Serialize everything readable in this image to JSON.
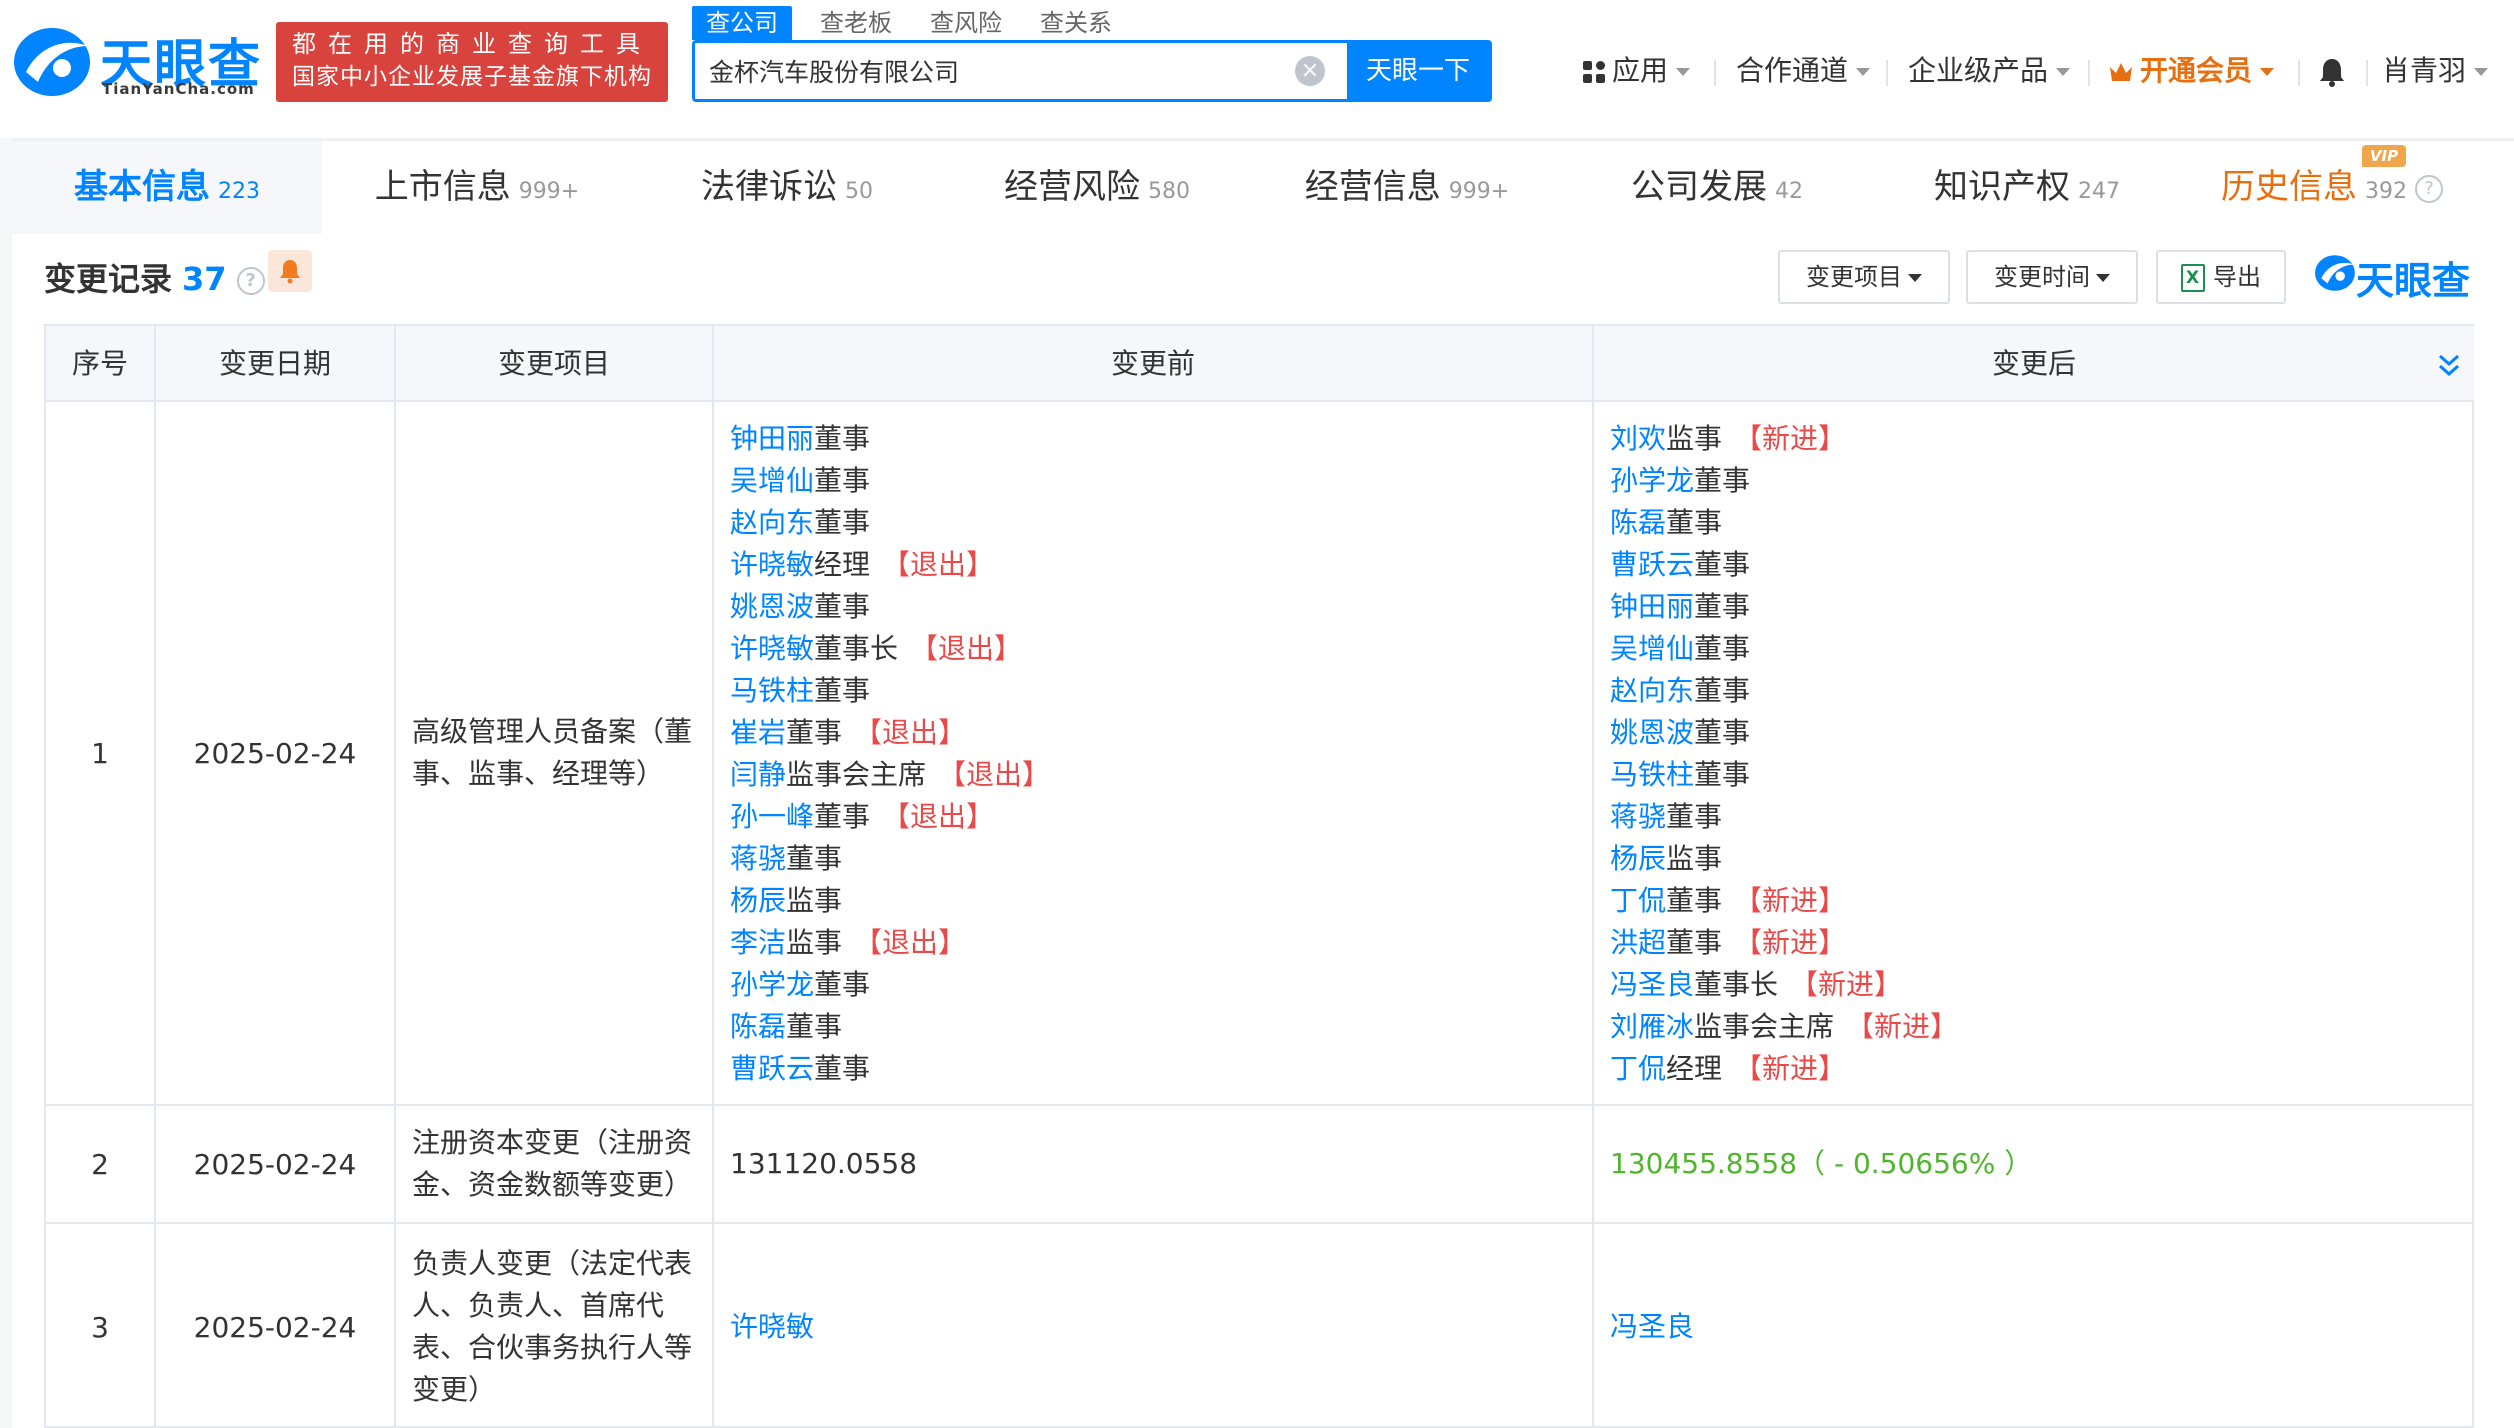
{
  "header": {
    "logo_text": "天眼查",
    "logo_sub": "TianYanCha.com",
    "slogan_line1": "都在用的商业查询工具",
    "slogan_line2": "国家中小企业发展子基金旗下机构",
    "search_tabs": [
      "查公司",
      "查老板",
      "查风险",
      "查关系"
    ],
    "search_value": "金杯汽车股份有限公司",
    "search_button": "天眼一下",
    "nav": {
      "apps": "应用",
      "partner": "合作通道",
      "enterprise": "企业级产品",
      "vip": "开通会员",
      "user": "肖青羽"
    }
  },
  "tabs": [
    {
      "label": "基本信息",
      "count": "223"
    },
    {
      "label": "上市信息",
      "count": "999+"
    },
    {
      "label": "法律诉讼",
      "count": "50"
    },
    {
      "label": "经营风险",
      "count": "580"
    },
    {
      "label": "经营信息",
      "count": "999+"
    },
    {
      "label": "公司发展",
      "count": "42"
    },
    {
      "label": "知识产权",
      "count": "247"
    },
    {
      "label": "历史信息",
      "count": "392",
      "badge": "VIP"
    }
  ],
  "section": {
    "title": "变更记录",
    "count": "37",
    "filter_item": "变更项目",
    "filter_time": "变更时间",
    "export": "导出",
    "brand": "天眼查"
  },
  "table": {
    "headers": [
      "序号",
      "变更日期",
      "变更项目",
      "变更前",
      "变更后"
    ],
    "rows": [
      {
        "index": "1",
        "date": "2025-02-24",
        "item": "高级管理人员备案（董事、监事、经理等）",
        "before": [
          {
            "name": "钟田丽",
            "role": "董事",
            "tag": ""
          },
          {
            "name": "吴增仙",
            "role": "董事",
            "tag": ""
          },
          {
            "name": "赵向东",
            "role": "董事",
            "tag": ""
          },
          {
            "name": "许晓敏",
            "role": "经理",
            "tag": "【退出】"
          },
          {
            "name": "姚恩波",
            "role": "董事",
            "tag": ""
          },
          {
            "name": "许晓敏",
            "role": "董事长",
            "tag": "【退出】"
          },
          {
            "name": "马铁柱",
            "role": "董事",
            "tag": ""
          },
          {
            "name": "崔岩",
            "role": "董事",
            "tag": "【退出】"
          },
          {
            "name": "闫静",
            "role": "监事会主席",
            "tag": "【退出】"
          },
          {
            "name": "孙一峰",
            "role": "董事",
            "tag": "【退出】"
          },
          {
            "name": "蒋骁",
            "role": "董事",
            "tag": ""
          },
          {
            "name": "杨辰",
            "role": "监事",
            "tag": ""
          },
          {
            "name": "李洁",
            "role": "监事",
            "tag": "【退出】"
          },
          {
            "name": "孙学龙",
            "role": "董事",
            "tag": ""
          },
          {
            "name": "陈磊",
            "role": "董事",
            "tag": ""
          },
          {
            "name": "曹跃云",
            "role": "董事",
            "tag": ""
          }
        ],
        "after": [
          {
            "name": "刘欢",
            "role": "监事",
            "tag": "【新进】"
          },
          {
            "name": "孙学龙",
            "role": "董事",
            "tag": ""
          },
          {
            "name": "陈磊",
            "role": "董事",
            "tag": ""
          },
          {
            "name": "曹跃云",
            "role": "董事",
            "tag": ""
          },
          {
            "name": "钟田丽",
            "role": "董事",
            "tag": ""
          },
          {
            "name": "吴增仙",
            "role": "董事",
            "tag": ""
          },
          {
            "name": "赵向东",
            "role": "董事",
            "tag": ""
          },
          {
            "name": "姚恩波",
            "role": "董事",
            "tag": ""
          },
          {
            "name": "马铁柱",
            "role": "董事",
            "tag": ""
          },
          {
            "name": "蒋骁",
            "role": "董事",
            "tag": ""
          },
          {
            "name": "杨辰",
            "role": "监事",
            "tag": ""
          },
          {
            "name": "丁侃",
            "role": "董事",
            "tag": "【新进】"
          },
          {
            "name": "洪超",
            "role": "董事",
            "tag": "【新进】"
          },
          {
            "name": "冯圣良",
            "role": "董事长",
            "tag": "【新进】"
          },
          {
            "name": "刘雁冰",
            "role": "监事会主席",
            "tag": "【新进】"
          },
          {
            "name": "丁侃",
            "role": "经理",
            "tag": "【新进】"
          }
        ]
      },
      {
        "index": "2",
        "date": "2025-02-24",
        "item": "注册资本变更（注册资金、资金数额等变更）",
        "before": "131120.0558",
        "after": "130455.8558（ - 0.50656% ）"
      },
      {
        "index": "3",
        "date": "2025-02-24",
        "item": "负责人变更（法定代表人、负责人、首席代表、合伙事务执行人等变更）",
        "before": "许晓敏",
        "after": "冯圣良"
      }
    ]
  },
  "colors": {
    "brand_blue": "#0084ff",
    "slogan_red": "#d9433d",
    "vip_orange": "#e86f0f",
    "exit_red": "#e84a4a",
    "increase_green": "#4fb62b"
  },
  "icons": [
    "logo-mark-icon",
    "clear-icon",
    "apps-grid-icon",
    "crown-icon",
    "bell-icon",
    "help-icon",
    "excel-icon",
    "collapse-icon"
  ]
}
